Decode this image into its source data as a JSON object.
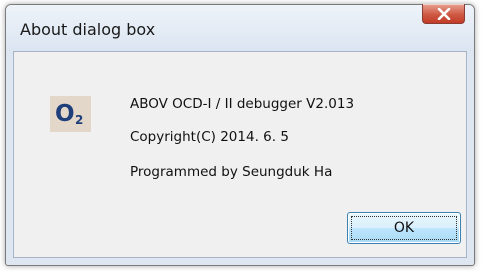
{
  "window": {
    "title": "About dialog box",
    "close_icon": "close-x-icon"
  },
  "logo": {
    "letter": "O",
    "subscript": "2"
  },
  "info": {
    "product": "ABOV OCD-I / II debugger V2.013",
    "copyright": "Copyright(C) 2014. 6. 5",
    "author": "Programmed by Seungduk Ha"
  },
  "buttons": {
    "ok_label": "OK"
  },
  "colors": {
    "title_bar": "#dde6f1",
    "close_button": "#c7452f",
    "client_background": "#f0f0f0",
    "logo_background": "#e3d7ca",
    "logo_text": "#1f3f7a",
    "ok_button_border": "#3c7fb1"
  }
}
